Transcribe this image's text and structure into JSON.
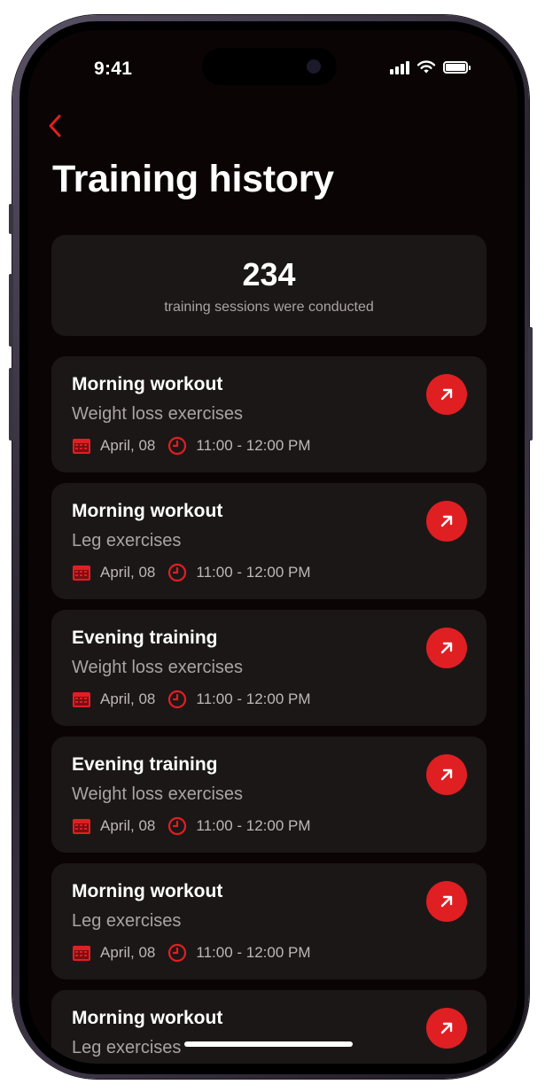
{
  "status_bar": {
    "time": "9:41"
  },
  "header": {
    "back_icon": "chevron-left-icon",
    "title": "Training history"
  },
  "summary": {
    "count": "234",
    "caption": "training sessions were conducted"
  },
  "sessions": [
    {
      "title": "Morning workout",
      "subtitle": "Weight loss exercises",
      "date": "April, 08",
      "time": "11:00 - 12:00 PM"
    },
    {
      "title": "Morning workout",
      "subtitle": "Leg exercises",
      "date": "April, 08",
      "time": "11:00 - 12:00 PM"
    },
    {
      "title": "Evening training",
      "subtitle": "Weight loss exercises",
      "date": "April, 08",
      "time": "11:00 - 12:00 PM"
    },
    {
      "title": "Evening training",
      "subtitle": "Weight loss exercises",
      "date": "April, 08",
      "time": "11:00 - 12:00 PM"
    },
    {
      "title": "Morning workout",
      "subtitle": "Leg exercises",
      "date": "April, 08",
      "time": "11:00 - 12:00 PM"
    },
    {
      "title": "Morning workout",
      "subtitle": "Leg exercises",
      "date": "",
      "time": ""
    }
  ],
  "icons": {
    "date": "calendar-icon",
    "time": "clock-icon",
    "open": "arrow-up-right-icon"
  },
  "colors": {
    "accent": "#e01f23",
    "background": "#0a0404",
    "card": "#1c1717",
    "secondary_text": "#a9a4a4"
  }
}
